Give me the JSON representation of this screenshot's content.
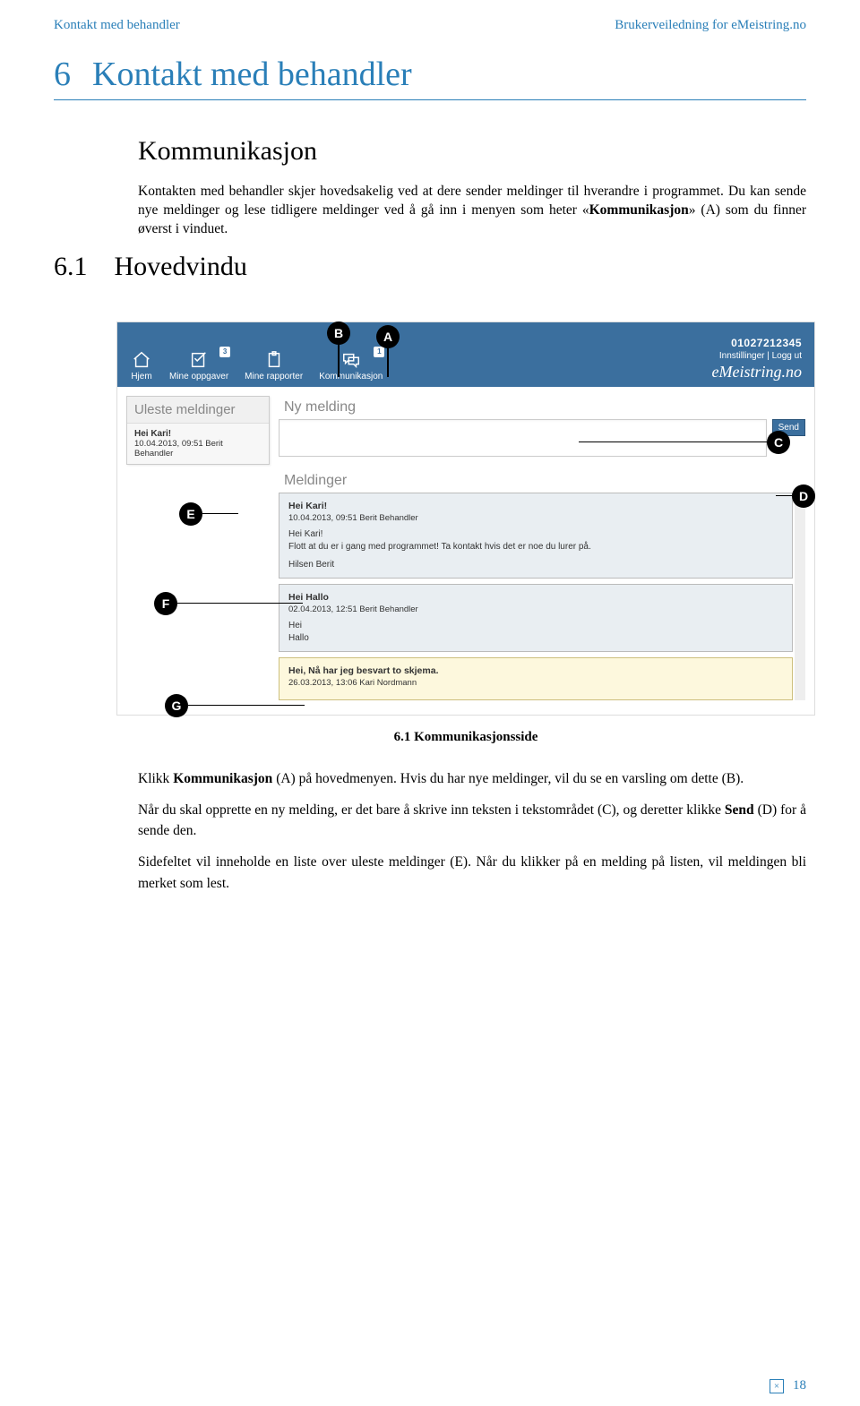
{
  "header": {
    "left": "Kontakt med behandler",
    "right": "Brukerveiledning for eMeistring.no"
  },
  "h6": {
    "num": "6",
    "text": "Kontakt med behandler"
  },
  "sub1": "Kommunikasjon",
  "para1a": "Kontakten med behandler skjer hovedsakelig ved at dere sender meldinger til hverandre i programmet. Du kan sende nye meldinger og lese tidligere meldinger ved å gå inn i menyen som heter «",
  "para1b": "Kommunikasjon",
  "para1c": "» (A) som du finner øverst i vinduet.",
  "h61": {
    "num": "6.1",
    "text": "Hovedvindu"
  },
  "callouts": {
    "A": "A",
    "B": "B",
    "C": "C",
    "D": "D",
    "E": "E",
    "F": "F",
    "G": "G"
  },
  "app": {
    "nav": {
      "hjem": "Hjem",
      "oppg": "Mine oppgaver",
      "rapp": "Mine rapporter",
      "komm": "Kommunikasjon",
      "badge_oppg": "3",
      "badge_komm": "1"
    },
    "headerRight": {
      "userid": "01027212345",
      "settings": "Innstillinger",
      "sep": " | ",
      "logout": "Logg ut",
      "brand1": "e",
      "brand2": "Meistring.no"
    },
    "sidebar": {
      "title": "Uleste meldinger",
      "msg_subject": "Hei Kari!",
      "msg_meta": "10.04.2013, 09:51 Berit Behandler"
    },
    "main": {
      "ny_title": "Ny melding",
      "send": "Send",
      "meld_title": "Meldinger",
      "messages": [
        {
          "subject": "Hei Kari!",
          "meta": "10.04.2013, 09:51 Berit Behandler",
          "greet": "Hei Kari!",
          "body": "Flott at du er i gang med programmet! Ta kontakt hvis det er noe du lurer på.",
          "sign": "Hilsen Berit"
        },
        {
          "subject": "Hei Hallo",
          "meta": "02.04.2013, 12:51 Berit Behandler",
          "greet": "Hei",
          "body": "Hallo",
          "sign": ""
        },
        {
          "subject": "Hei, Nå har jeg besvart to skjema.",
          "meta": "26.03.2013, 13:06 Kari Nordmann",
          "greet": "",
          "body": "",
          "sign": ""
        }
      ]
    }
  },
  "figcap": "6.1 Kommunikasjonsside",
  "body2": {
    "p1a": "Klikk ",
    "p1b": "Kommunikasjon",
    "p1c": " (A) på hovedmenyen. Hvis du har nye meldinger, vil du se en varsling om dette (B).",
    "p2a": "Når du skal opprette en ny melding, er det bare å skrive inn teksten i tekstområdet (C), og deretter klikke ",
    "p2b": "Send",
    "p2c": " (D) for å sende den.",
    "p3": "Sidefeltet vil inneholde en liste over uleste meldinger (E). Når du klikker på en melding på listen, vil meldingen bli merket som lest."
  },
  "footer": {
    "pagenum": "18",
    "x": "×"
  }
}
